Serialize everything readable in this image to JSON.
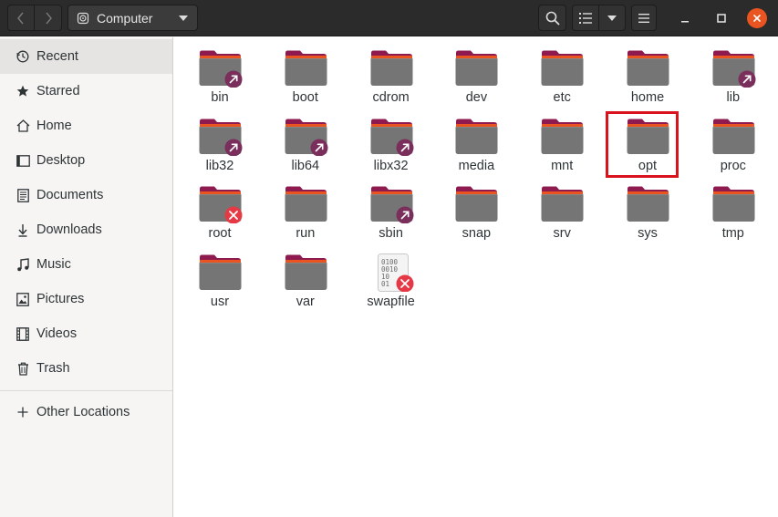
{
  "window": {
    "location_label": "Computer"
  },
  "sidebar": {
    "items": [
      {
        "label": "Recent",
        "icon": "recent-icon",
        "active": true
      },
      {
        "label": "Starred",
        "icon": "star-icon"
      },
      {
        "label": "Home",
        "icon": "home-icon"
      },
      {
        "label": "Desktop",
        "icon": "desktop-icon"
      },
      {
        "label": "Documents",
        "icon": "documents-icon"
      },
      {
        "label": "Downloads",
        "icon": "downloads-icon"
      },
      {
        "label": "Music",
        "icon": "music-icon"
      },
      {
        "label": "Pictures",
        "icon": "pictures-icon"
      },
      {
        "label": "Videos",
        "icon": "videos-icon"
      },
      {
        "label": "Trash",
        "icon": "trash-icon"
      }
    ],
    "other_locations": {
      "label": "Other Locations",
      "icon": "plus-icon"
    }
  },
  "files": [
    {
      "name": "bin",
      "kind": "folder",
      "emblem": "link"
    },
    {
      "name": "boot",
      "kind": "folder"
    },
    {
      "name": "cdrom",
      "kind": "folder"
    },
    {
      "name": "dev",
      "kind": "folder"
    },
    {
      "name": "etc",
      "kind": "folder"
    },
    {
      "name": "home",
      "kind": "folder"
    },
    {
      "name": "lib",
      "kind": "folder",
      "emblem": "link"
    },
    {
      "name": "lib32",
      "kind": "folder",
      "emblem": "link"
    },
    {
      "name": "lib64",
      "kind": "folder",
      "emblem": "link"
    },
    {
      "name": "libx32",
      "kind": "folder",
      "emblem": "link"
    },
    {
      "name": "media",
      "kind": "folder"
    },
    {
      "name": "mnt",
      "kind": "folder"
    },
    {
      "name": "opt",
      "kind": "folder",
      "highlighted": true
    },
    {
      "name": "proc",
      "kind": "folder"
    },
    {
      "name": "root",
      "kind": "folder",
      "emblem": "unreadable"
    },
    {
      "name": "run",
      "kind": "folder"
    },
    {
      "name": "sbin",
      "kind": "folder",
      "emblem": "link"
    },
    {
      "name": "snap",
      "kind": "folder"
    },
    {
      "name": "srv",
      "kind": "folder"
    },
    {
      "name": "sys",
      "kind": "folder"
    },
    {
      "name": "tmp",
      "kind": "folder"
    },
    {
      "name": "usr",
      "kind": "folder"
    },
    {
      "name": "var",
      "kind": "folder"
    },
    {
      "name": "swapfile",
      "kind": "binary-file",
      "emblem": "unreadable",
      "icon_text": [
        "0100",
        "0010",
        "10",
        "01"
      ]
    }
  ],
  "colors": {
    "headerbar": "#2b2b2b",
    "folder_body": "#757575",
    "folder_tab": "#8f1a4f",
    "folder_stripe": "#e95420",
    "link_emblem": "#7a2e5b",
    "unreadable_emblem": "#e63946",
    "highlight_box": "#d9121d",
    "close_button": "#e95420"
  }
}
